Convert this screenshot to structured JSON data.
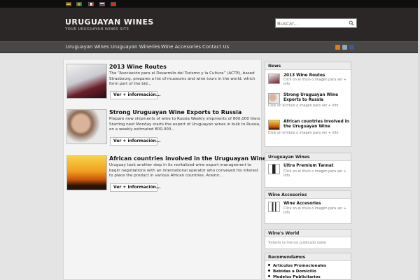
{
  "languages": [
    {
      "name": "spanish-flag",
      "color_a": "#c60b1e",
      "color_b": "#ffc400"
    },
    {
      "name": "brazil-flag",
      "color_a": "#009c3b",
      "color_b": "#ffdf00"
    },
    {
      "name": "france-flag",
      "color_a": "#0055a4",
      "color_b": "#ef4135"
    },
    {
      "name": "russia-flag",
      "color_a": "#ffffff",
      "color_b": "#d52b1e"
    },
    {
      "name": "china-flag",
      "color_a": "#de2910",
      "color_b": "#ffde00"
    }
  ],
  "header": {
    "title": "URUGUAYAN WINES",
    "tagline": "YOUR URUGUAYAN WINES SITE",
    "search_placeholder": "Buscar...",
    "search_icon": "search-icon"
  },
  "nav": {
    "items": [
      "Uruguayan Wines",
      "Uruguayan Wineries",
      "Wine Accesories",
      "Contact Us"
    ],
    "social_icons": [
      "rss-icon",
      "twitter-icon",
      "facebook-icon"
    ]
  },
  "posts": [
    {
      "title": "2013 Wine Routes",
      "excerpt": "The “Asociación para el Desarrollo del Turismo y la Cultura” (ACTE), based Strasbourg, prepares a list of museums and wine tours in the world, which form part of the bid...",
      "more": "Ver + información..."
    },
    {
      "title": "Strong Uruguayan Wine Exports to Russia",
      "excerpt": "Prepare new shipments of wine to Russia Weekly shipments of 800,000 liters Starting next Monday starts the export of Uruguayan wines in bulk to Russia, on a weekly estimated 800,000...",
      "more": "Ver + información..."
    },
    {
      "title": "African countries involved in the Uruguayan Wine",
      "excerpt": "Uruguay took another step in its revitalized wine export management to begin negotiations with an international operator who conveyed his interest to place the product in various African countries. Aramir...",
      "more": "Ver + información..."
    }
  ],
  "sidebar": {
    "news": {
      "heading": "News",
      "items": [
        {
          "title": "2013 Wine Routes",
          "sub": "Click on el titulo o imagen para ver + info"
        },
        {
          "title": "Strong Uruguayan Wine Exports to Russia",
          "sub": "Click on el titulo o imagen para ver + info"
        },
        {
          "title": "African countries involved in the Uruguayan Wine",
          "sub": "Click on el titulo o imagen para ver + info"
        }
      ]
    },
    "wines": {
      "heading": "Uruguayan Wines",
      "item": {
        "title": "Ultra Premium Tannat",
        "sub": "Click on el titulo o imagen para ver + info"
      }
    },
    "accesories": {
      "heading": "Wine Accesories",
      "item": {
        "title": "Wine Accesories",
        "sub": "Click on el titulo o imagen para ver + info"
      }
    },
    "world": {
      "heading": "Wine's World",
      "empty": "Todavía no hemos publicado nada!"
    },
    "recommended": {
      "heading": "Recomendamos",
      "items": [
        "Artículos Promocionales",
        "Bebidas a Domicilio",
        "Modelos Publicitarios"
      ]
    }
  }
}
